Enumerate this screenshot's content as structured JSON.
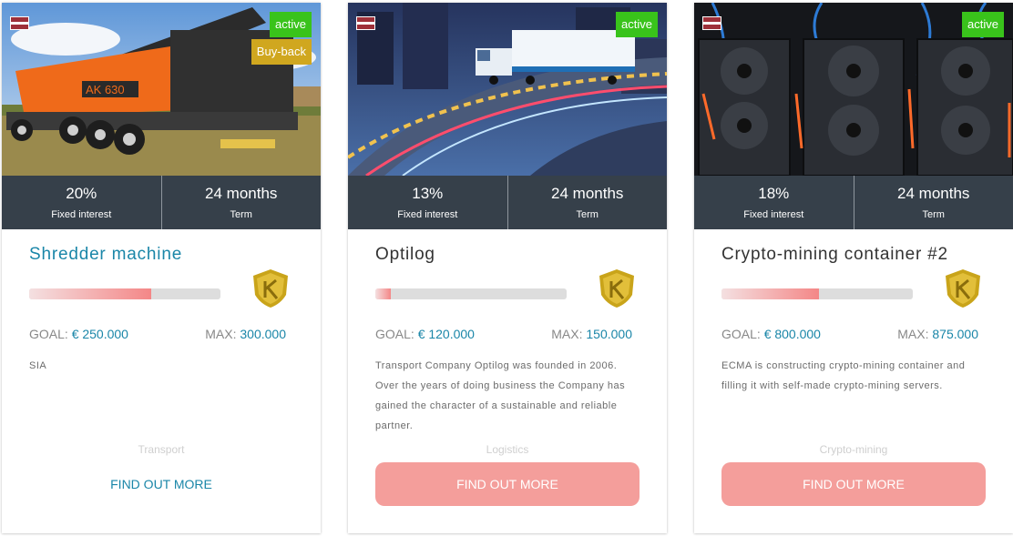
{
  "projects": [
    {
      "status": "active",
      "extra_badge": "Buy-back",
      "interest": "20%",
      "interest_label": "Fixed interest",
      "term": "24 months",
      "term_label": "Term",
      "title": "Shredder machine",
      "progress": 0.64,
      "goal_label": "GOAL:",
      "goal": "€ 250.000",
      "max_label": "MAX:",
      "max": "300.000",
      "description": "SIA",
      "category": "Transport",
      "cta": "FIND OUT MORE"
    },
    {
      "status": "active",
      "interest": "13%",
      "interest_label": "Fixed interest",
      "term": "24 months",
      "term_label": "Term",
      "title": "Optilog",
      "progress": 0.08,
      "goal_label": "GOAL:",
      "goal": "€ 120.000",
      "max_label": "MAX:",
      "max": "150.000",
      "description": "Transport Company Optilog was founded in 2006. Over the years of doing business the Company has gained the character of a sustainable and reliable partner.",
      "category": "Logistics",
      "cta": "FIND OUT MORE"
    },
    {
      "status": "active",
      "interest": "18%",
      "interest_label": "Fixed interest",
      "term": "24 months",
      "term_label": "Term",
      "title": "Crypto-mining container #2",
      "progress": 0.51,
      "goal_label": "GOAL:",
      "goal": "€ 800.000",
      "max_label": "MAX:",
      "max": "875.000",
      "description": "ECMA is constructing crypto-mining container and filling it with self-made crypto-mining servers.",
      "category": "Crypto-mining",
      "cta": "FIND OUT MORE"
    }
  ],
  "colors": {
    "accent": "#1a86a8",
    "active_badge": "#39c31b",
    "buyback_badge": "#d0a71f",
    "stats_bar": "#36404a",
    "cta_button": "#f49e9b",
    "progress_fill": "#f48787"
  },
  "icons": {
    "country_flag": "latvia-flag-icon",
    "rating": "k-shield-icon"
  }
}
